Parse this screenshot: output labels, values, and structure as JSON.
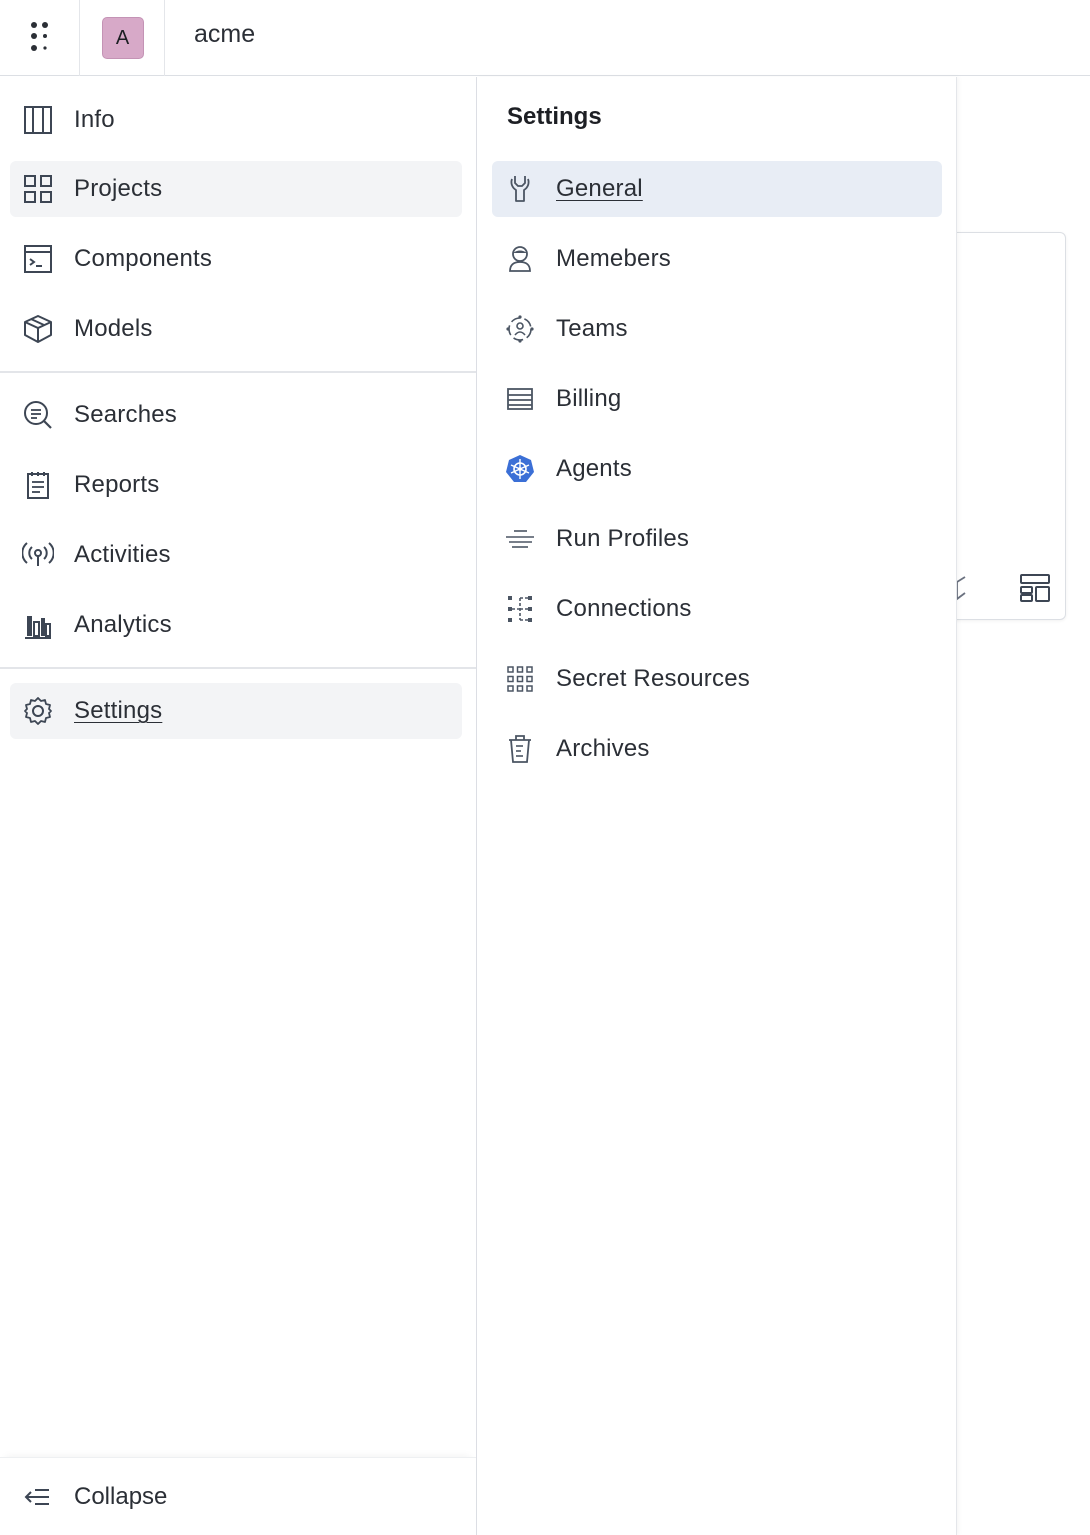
{
  "topbar": {
    "org_initial": "A",
    "org_name": "acme"
  },
  "sidebar": {
    "items": [
      {
        "label": "Info",
        "icon": "panel-columns-icon"
      },
      {
        "label": "Projects",
        "icon": "grid-icon",
        "active": true
      },
      {
        "label": "Components",
        "icon": "terminal-window-icon"
      },
      {
        "label": "Models",
        "icon": "cube-icon"
      },
      {
        "label": "Searches",
        "icon": "search-document-icon"
      },
      {
        "label": "Reports",
        "icon": "report-icon"
      },
      {
        "label": "Activities",
        "icon": "broadcast-icon"
      },
      {
        "label": "Analytics",
        "icon": "analytics-icon"
      },
      {
        "label": "Settings",
        "icon": "gear-icon",
        "active": true
      }
    ],
    "collapse_label": "Collapse"
  },
  "settings_menu": {
    "title": "Settings",
    "items": [
      {
        "label": "General",
        "icon": "wrench-icon",
        "active": true
      },
      {
        "label": "Memebers",
        "icon": "user-icon"
      },
      {
        "label": "Teams",
        "icon": "team-icon"
      },
      {
        "label": "Billing",
        "icon": "billing-icon"
      },
      {
        "label": "Agents",
        "icon": "kubernetes-icon"
      },
      {
        "label": "Run Profiles",
        "icon": "run-profiles-icon"
      },
      {
        "label": "Connections",
        "icon": "connections-icon"
      },
      {
        "label": "Secret Resources",
        "icon": "dots-grid-icon"
      },
      {
        "label": "Archives",
        "icon": "trash-icon"
      }
    ]
  },
  "colors": {
    "avatar_bg": "#d7a9c8",
    "active_nav_bg": "#f3f4f6",
    "active_sub_bg": "#e8edf5",
    "agents_icon": "#3b6fd6"
  }
}
